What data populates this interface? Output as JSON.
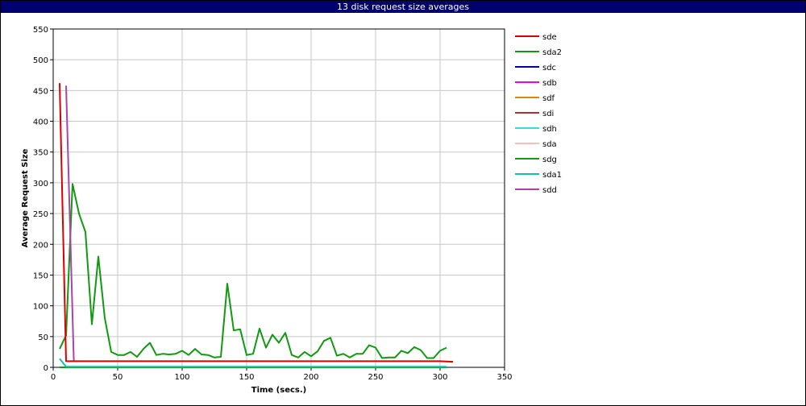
{
  "title": "13 disk request size averages",
  "chart_data": {
    "type": "line",
    "title": "13 disk request size averages",
    "xlabel": "Time (secs.)",
    "ylabel": "Average Request Size",
    "xlim": [
      0,
      350
    ],
    "ylim": [
      0,
      550
    ],
    "xticks": [
      0,
      50,
      100,
      150,
      200,
      250,
      300,
      350
    ],
    "yticks": [
      0,
      50,
      100,
      150,
      200,
      250,
      300,
      350,
      400,
      450,
      500,
      550
    ],
    "grid": true,
    "legend_position": "right",
    "series": [
      {
        "name": "sde",
        "color": "#dd0000",
        "points": [
          [
            5,
            462
          ],
          [
            10,
            10
          ],
          [
            50,
            10
          ],
          [
            100,
            10
          ],
          [
            150,
            10
          ],
          [
            200,
            10
          ],
          [
            250,
            10
          ],
          [
            300,
            10
          ],
          [
            310,
            9
          ]
        ]
      },
      {
        "name": "sda2",
        "color": "#119911",
        "points": [
          [
            5,
            30
          ],
          [
            10,
            52
          ],
          [
            15,
            298
          ],
          [
            20,
            250
          ],
          [
            25,
            220
          ],
          [
            30,
            70
          ],
          [
            35,
            180
          ],
          [
            40,
            80
          ],
          [
            45,
            25
          ],
          [
            50,
            20
          ],
          [
            55,
            20
          ],
          [
            60,
            25
          ],
          [
            65,
            17
          ],
          [
            70,
            30
          ],
          [
            75,
            40
          ],
          [
            80,
            20
          ],
          [
            85,
            22
          ],
          [
            90,
            21
          ],
          [
            95,
            22
          ],
          [
            100,
            27
          ],
          [
            105,
            20
          ],
          [
            110,
            30
          ],
          [
            115,
            21
          ],
          [
            120,
            20
          ],
          [
            125,
            16
          ],
          [
            130,
            17
          ],
          [
            135,
            136
          ],
          [
            140,
            60
          ],
          [
            145,
            62
          ],
          [
            150,
            20
          ],
          [
            155,
            22
          ],
          [
            160,
            63
          ],
          [
            165,
            32
          ],
          [
            170,
            53
          ],
          [
            175,
            40
          ],
          [
            180,
            56
          ],
          [
            185,
            20
          ],
          [
            190,
            16
          ],
          [
            195,
            25
          ],
          [
            200,
            18
          ],
          [
            205,
            26
          ],
          [
            210,
            43
          ],
          [
            215,
            48
          ],
          [
            220,
            19
          ],
          [
            225,
            22
          ],
          [
            230,
            16
          ],
          [
            235,
            22
          ],
          [
            240,
            22
          ],
          [
            245,
            36
          ],
          [
            250,
            32
          ],
          [
            255,
            15
          ],
          [
            260,
            16
          ],
          [
            265,
            16
          ],
          [
            270,
            27
          ],
          [
            275,
            23
          ],
          [
            280,
            33
          ],
          [
            285,
            28
          ],
          [
            290,
            15
          ],
          [
            295,
            15
          ],
          [
            300,
            27
          ],
          [
            305,
            32
          ]
        ]
      },
      {
        "name": "sdc",
        "color": "#0000aa",
        "points": [
          [
            5,
            0
          ],
          [
            305,
            0
          ]
        ]
      },
      {
        "name": "sdb",
        "color": "#ee00ee",
        "points": [
          [
            5,
            0
          ],
          [
            305,
            0
          ]
        ]
      },
      {
        "name": "sdf",
        "color": "#dd8800",
        "points": [
          [
            5,
            0
          ],
          [
            305,
            0
          ]
        ]
      },
      {
        "name": "sdi",
        "color": "#aa3333",
        "points": [
          [
            5,
            0
          ],
          [
            305,
            0
          ]
        ]
      },
      {
        "name": "sdh",
        "color": "#33dddd",
        "points": [
          [
            5,
            0
          ],
          [
            305,
            0
          ]
        ]
      },
      {
        "name": "sda",
        "color": "#ffbbbb",
        "points": [
          [
            5,
            0
          ],
          [
            305,
            0
          ]
        ]
      },
      {
        "name": "sdg",
        "color": "#119911",
        "points": [
          [
            5,
            0
          ],
          [
            305,
            0
          ]
        ]
      },
      {
        "name": "sda1",
        "color": "#11bbbb",
        "points": [
          [
            5,
            14
          ],
          [
            10,
            1
          ],
          [
            50,
            1
          ],
          [
            100,
            1
          ],
          [
            150,
            1
          ],
          [
            200,
            1
          ],
          [
            250,
            1
          ],
          [
            305,
            1
          ]
        ]
      },
      {
        "name": "sdd",
        "color": "#aa44aa",
        "points": [
          [
            10,
            458
          ],
          [
            16,
            10
          ]
        ]
      }
    ]
  }
}
